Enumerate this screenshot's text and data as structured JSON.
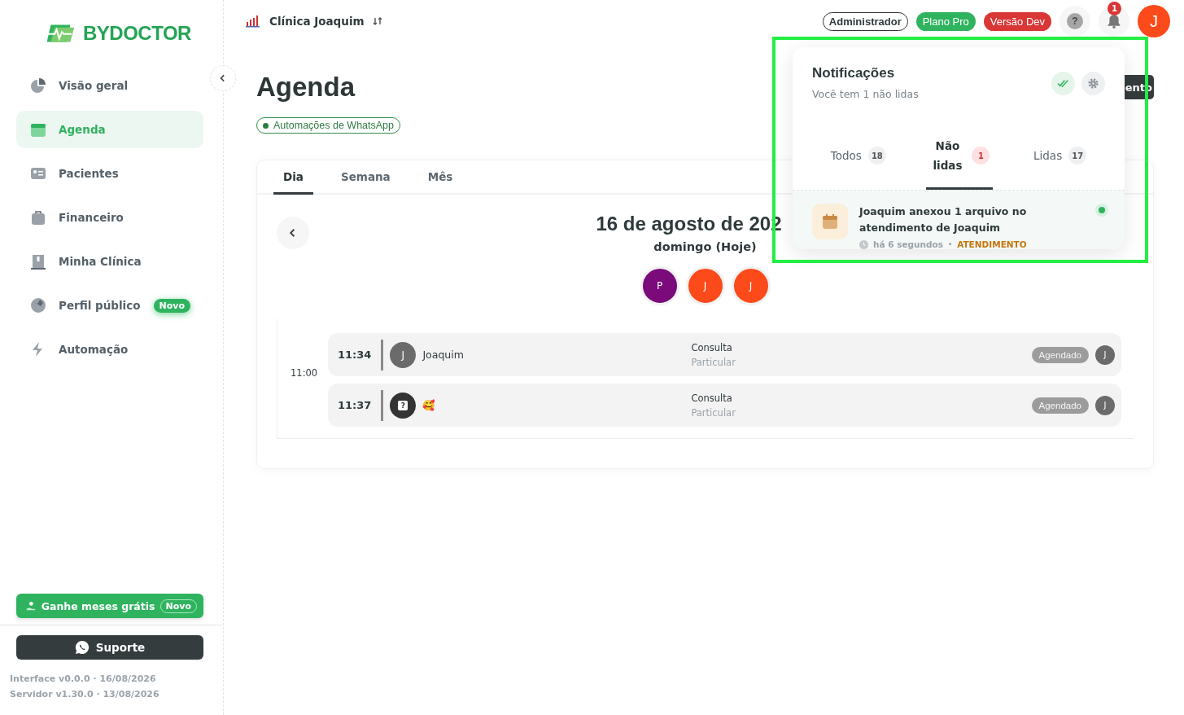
{
  "brand": {
    "name": "BYDOCTOR"
  },
  "sidebar": {
    "items": [
      {
        "label": "Visão geral",
        "selected": false
      },
      {
        "label": "Agenda",
        "selected": true
      },
      {
        "label": "Pacientes",
        "selected": false
      },
      {
        "label": "Financeiro",
        "selected": false
      },
      {
        "label": "Minha Clínica",
        "selected": false
      },
      {
        "label": "Perfil público",
        "selected": false,
        "badge": "Novo"
      },
      {
        "label": "Automação",
        "selected": false
      }
    ],
    "promo": {
      "label": "Ganhe meses grátis",
      "badge": "Novo"
    },
    "support": "Suporte",
    "versions": [
      "Interface v0.0.0 · 16/08/2026",
      "Servidor v1.30.0 · 13/08/2026"
    ]
  },
  "topbar": {
    "clinic": "Clínica Joaquim",
    "badges": [
      {
        "label": "Administrador",
        "kind": "outline"
      },
      {
        "label": "Plano Pro",
        "kind": "green"
      },
      {
        "label": "Versão Dev",
        "kind": "red"
      }
    ],
    "help": "?",
    "bell_count": "1",
    "avatar": "J"
  },
  "page": {
    "title": "Agenda",
    "chip": "Automações de WhatsApp",
    "action": "ento"
  },
  "calendar": {
    "tabs": [
      {
        "label": "Dia",
        "selected": true
      },
      {
        "label": "Semana",
        "selected": false
      },
      {
        "label": "Mês",
        "selected": false
      }
    ],
    "date": "16 de agosto de 202",
    "weekday": "domingo (Hoje)",
    "professionals": [
      {
        "initial": "P",
        "color": "#7b0a7b"
      },
      {
        "initial": "J",
        "color": "#fc4a1a"
      },
      {
        "initial": "J",
        "color": "#fc4a1a"
      }
    ],
    "hour": "11:00",
    "appointments": [
      {
        "time": "11:34",
        "avatar": "J",
        "kind": "letter",
        "patient": "Joaquim",
        "type": "Consulta",
        "payment": "Particular",
        "status": "Agendado",
        "doctor": "J"
      },
      {
        "time": "11:37",
        "avatar": "?",
        "kind": "unknown",
        "patient": "🥰",
        "type": "Consulta",
        "payment": "Particular",
        "status": "Agendado",
        "doctor": "J"
      }
    ]
  },
  "notifications": {
    "title": "Notificações",
    "subtitle": "Você tem 1 não lidas",
    "tabs": [
      {
        "label": "Todos",
        "count": "18",
        "selected": false
      },
      {
        "label": "Não lidas",
        "count": "1",
        "selected": true
      },
      {
        "label": "Lidas",
        "count": "17",
        "selected": false
      }
    ],
    "items": [
      {
        "text": "Joaquim anexou 1 arquivo no atendimento de Joaquim",
        "time": "há 6 segundos",
        "separator": "•",
        "category": "ATENDIMENTO",
        "unread": true
      }
    ]
  }
}
